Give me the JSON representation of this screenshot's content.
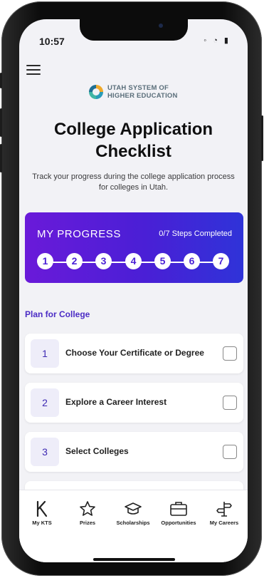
{
  "status": {
    "time": "10:57",
    "icons": "◦ ◔ ▮"
  },
  "logo": {
    "line1": "UTAH SYSTEM OF",
    "line2": "HIGHER EDUCATION"
  },
  "page": {
    "title_line1": "College Application",
    "title_line2": "Checklist",
    "subtitle": "Track your progress during the college application process for colleges in Utah."
  },
  "progress": {
    "title": "MY PROGRESS",
    "count": "0/7 Steps Completed",
    "steps": [
      "1",
      "2",
      "3",
      "4",
      "5",
      "6",
      "7"
    ]
  },
  "section": {
    "label": "Plan for College"
  },
  "items": [
    {
      "num": "1",
      "label": "Choose Your Certificate or Degree",
      "checked": false
    },
    {
      "num": "2",
      "label": "Explore a Career Interest",
      "checked": false
    },
    {
      "num": "3",
      "label": "Select Colleges",
      "checked": false
    }
  ],
  "tabs": [
    {
      "label": "My KTS",
      "icon": "kts-logo-icon"
    },
    {
      "label": "Prizes",
      "icon": "star-icon"
    },
    {
      "label": "Scholarships",
      "icon": "graduation-cap-icon"
    },
    {
      "label": "Opportunities",
      "icon": "briefcase-icon"
    },
    {
      "label": "My Careers",
      "icon": "signpost-icon"
    }
  ],
  "colors": {
    "accent": "#4b2cc5",
    "progress_start": "#6a1ad9",
    "progress_end": "#2f33d8",
    "background": "#f2f2f6"
  }
}
